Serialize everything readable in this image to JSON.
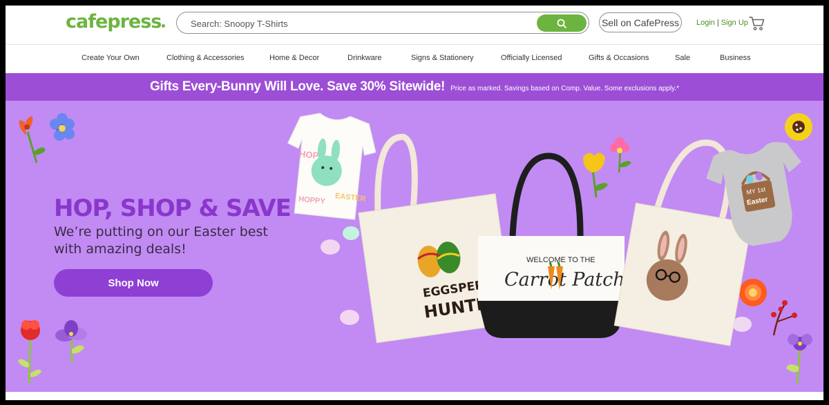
{
  "header": {
    "logo": "cafepress",
    "search_placeholder": "Search: Snoopy T-Shirts",
    "search_icon": "search-icon",
    "sell_label": "Sell on CafePress",
    "login_label": "Login",
    "separator": "|",
    "signup_label": "Sign Up",
    "cart_icon": "cart-icon"
  },
  "nav": {
    "items": [
      "Create Your Own",
      "Clothing & Accessories",
      "Home & Decor",
      "Drinkware",
      "Signs & Stationery",
      "Officially Licensed",
      "Gifts & Occasions",
      "Sale",
      "Business"
    ]
  },
  "promo": {
    "headline": "Gifts Every-Bunny Will Love.  Save 30% Sitewide!",
    "fine_print": "Price as marked. Savings based on Comp. Value.  Some exclusions apply.*"
  },
  "hero": {
    "title": "HOP, SHOP & SAVE",
    "subtitle": "We’re putting on our Easter best with amazing deals!",
    "cta": "Shop Now",
    "products": {
      "tshirt_text": "HOPPY EASTER",
      "tote_left_text_1": "EGGSPERT",
      "tote_left_text_2": "HUNTER",
      "tote_center_text_1": "WELCOME TO THE",
      "tote_center_text_2": "Carrot Patch",
      "onesie_text_1": "MY 1st",
      "onesie_text_2": "Easter"
    }
  },
  "colors": {
    "brand_green": "#6cb43f",
    "promo_purple": "#9c4ed6",
    "hero_bg": "#c18bf3",
    "hero_title": "#8a36cc",
    "cta_bg": "#8e3fd4"
  }
}
